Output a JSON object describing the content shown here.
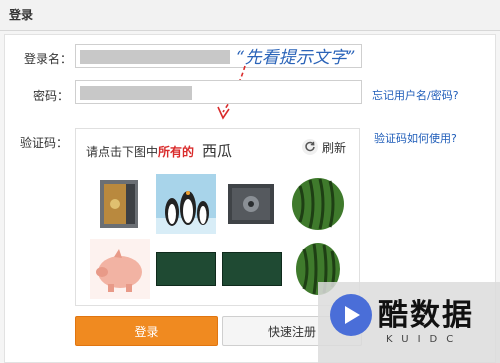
{
  "header": {
    "title": "登录"
  },
  "form": {
    "username_label": "登录名：",
    "password_label": "密码：",
    "captcha_label": "验证码：",
    "hint": "“先看提示文字”",
    "forgot_link": "忘记用户名/密码?",
    "captcha_help_link": "验证码如何使用?"
  },
  "captcha": {
    "instruction_prefix": "请点击下图中",
    "instruction_highlight": "所有的",
    "instruction_target": "西瓜",
    "refresh_label": "刷新",
    "tiles": [
      "safe",
      "penguins",
      "safe",
      "watermelon",
      "piggy-bank",
      "blank",
      "blank",
      "watermelon"
    ]
  },
  "buttons": {
    "login": "登录",
    "register": "快速注册"
  },
  "logo": {
    "text": "酷数据",
    "subtext": "KUIDC"
  },
  "colors": {
    "accent": "#f08a20",
    "link": "#1f5db9",
    "highlight": "#d92b2b"
  }
}
